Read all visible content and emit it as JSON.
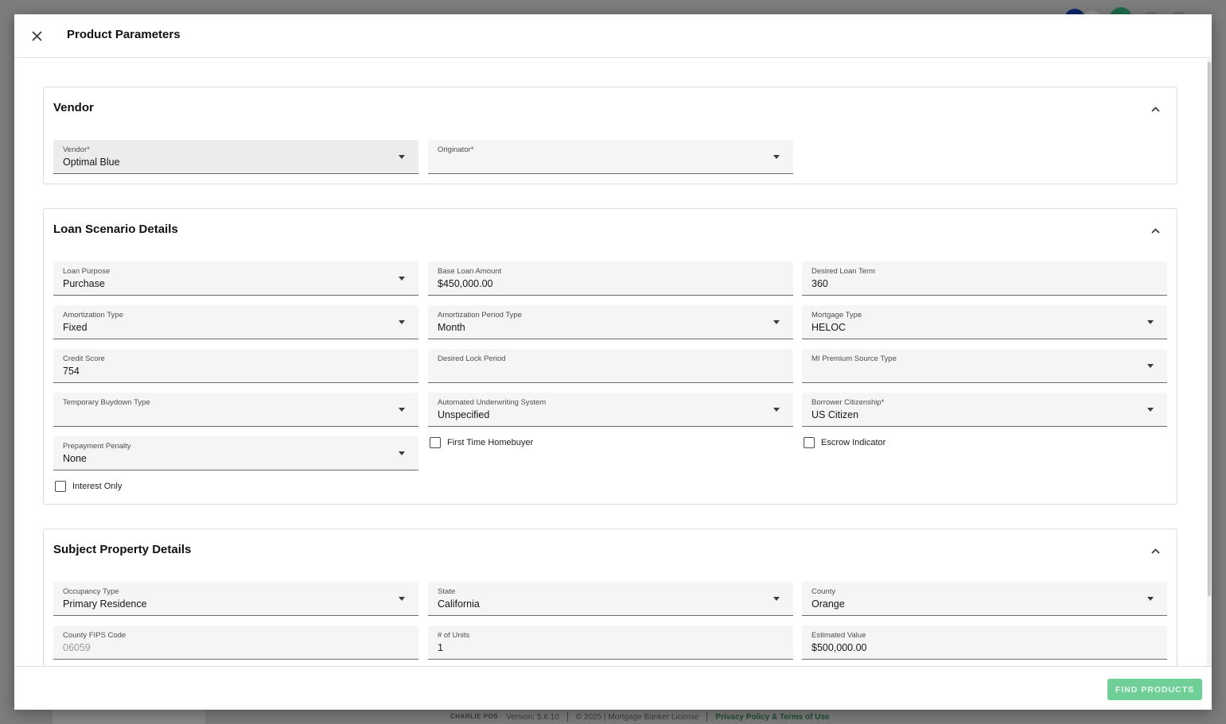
{
  "modal": {
    "title": "Product Parameters",
    "find_button": "FIND PRODUCTS"
  },
  "vendor_section": {
    "title": "Vendor",
    "fields": {
      "vendor": {
        "label": "Vendor*",
        "value": "Optimal Blue"
      },
      "originator": {
        "label": "Originator*",
        "value": ""
      }
    }
  },
  "loan_section": {
    "title": "Loan Scenario Details",
    "fields": {
      "loan_purpose": {
        "label": "Loan Purpose",
        "value": "Purchase"
      },
      "base_loan_amount": {
        "label": "Base Loan Amount",
        "value": "$450,000.00"
      },
      "desired_loan_term": {
        "label": "Desired Loan Term",
        "value": "360"
      },
      "amortization_type": {
        "label": "Amortization Type",
        "value": "Fixed"
      },
      "amortization_period_type": {
        "label": "Amortization Period Type",
        "value": "Month"
      },
      "mortgage_type": {
        "label": "Mortgage Type",
        "value": "HELOC"
      },
      "credit_score": {
        "label": "Credit Score",
        "value": "754"
      },
      "desired_lock_period": {
        "label": "Desired Lock Period",
        "value": ""
      },
      "mi_premium_source_type": {
        "label": "MI Premium Source Type",
        "value": ""
      },
      "temporary_buydown_type": {
        "label": "Temporary Buydown Type",
        "value": ""
      },
      "automated_underwriting_system": {
        "label": "Automated Underwriting System",
        "value": "Unspecified"
      },
      "borrower_citizenship": {
        "label": "Borrower Citizenship*",
        "value": "US Citizen"
      },
      "prepayment_penalty": {
        "label": "Prepayment Penalty",
        "value": "None"
      }
    },
    "checkboxes": {
      "first_time_homebuyer": "First Time Homebuyer",
      "escrow_indicator": "Escrow Indicator",
      "interest_only": "Interest Only"
    }
  },
  "property_section": {
    "title": "Subject Property Details",
    "fields": {
      "occupancy_type": {
        "label": "Occupancy Type",
        "value": "Primary Residence"
      },
      "state": {
        "label": "State",
        "value": "California"
      },
      "county": {
        "label": "County",
        "value": "Orange"
      },
      "county_fips_code": {
        "label": "County FIPS Code",
        "value": "06059"
      },
      "num_units": {
        "label": "# of Units",
        "value": "1"
      },
      "estimated_value": {
        "label": "Estimated Value",
        "value": "$500,000.00"
      }
    }
  },
  "background_footer": {
    "logo": "CHARLIE POS",
    "version": "Version: 5.6.10",
    "copyright": "© 2025 | Mortgage Banker License",
    "privacy_link": "Privacy Policy & Terms of Use"
  },
  "colors": {
    "find_button": "#6fcf97",
    "overlay": "#7d7d7d",
    "field_bg": "#f5f5f5"
  },
  "icons": {
    "close": "close-icon",
    "collapse": "chevron-up-icon",
    "dropdown": "caret-down-icon"
  }
}
